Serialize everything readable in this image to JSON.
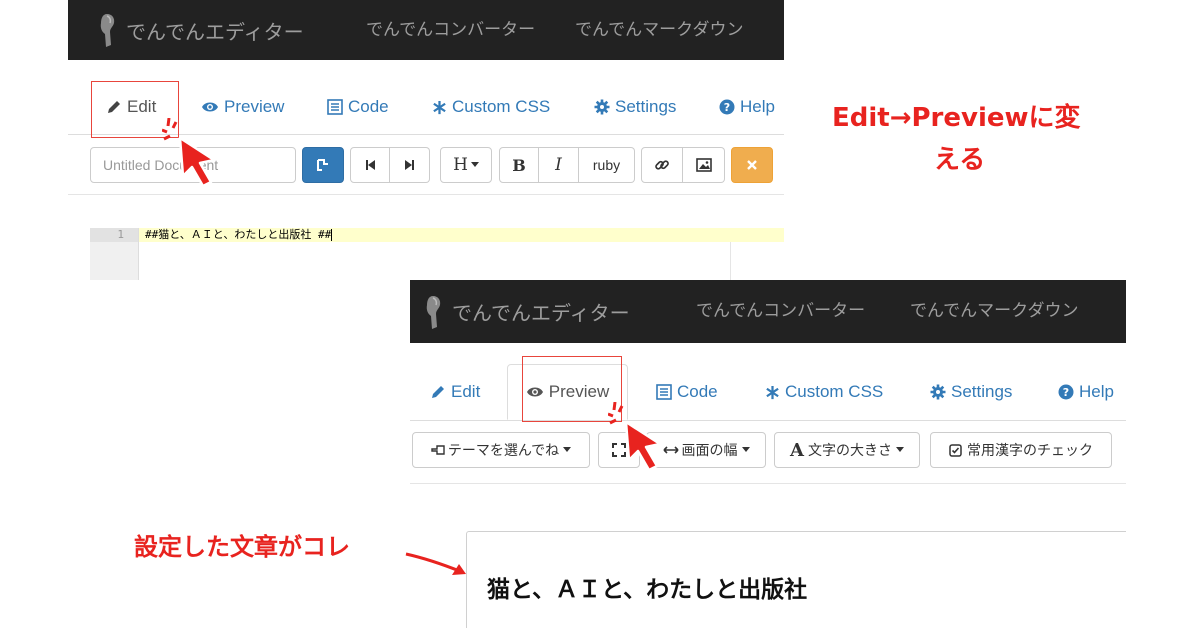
{
  "edit_screen": {
    "brand": "でんでんエディター",
    "nav": [
      "でんでんコンバーター",
      "でんでんマークダウン"
    ],
    "tabs": [
      {
        "label": "Edit",
        "icon": "pencil-icon"
      },
      {
        "label": "Preview",
        "icon": "eye-icon"
      },
      {
        "label": "Code",
        "icon": "list-icon"
      },
      {
        "label": "Custom CSS",
        "icon": "asterisk-icon"
      },
      {
        "label": "Settings",
        "icon": "gear-icon"
      },
      {
        "label": "Help",
        "icon": "question-circle-icon"
      }
    ],
    "active_tab": "Edit",
    "toolbar": {
      "title_placeholder": "Untitled Document",
      "heading_label": "H",
      "bold_label": "B",
      "italic_label": "I",
      "ruby_label": "ruby"
    },
    "editor": {
      "line_number": "1",
      "line_text": "##猫と、ＡＩと、わたしと出版社 ##"
    }
  },
  "preview_screen": {
    "brand": "でんでんエディター",
    "nav": [
      "でんでんコンバーター",
      "でんでんマークダウン"
    ],
    "tabs": [
      {
        "label": "Edit",
        "icon": "pencil-icon"
      },
      {
        "label": "Preview",
        "icon": "eye-icon"
      },
      {
        "label": "Code",
        "icon": "list-icon"
      },
      {
        "label": "Custom CSS",
        "icon": "asterisk-icon"
      },
      {
        "label": "Settings",
        "icon": "gear-icon"
      },
      {
        "label": "Help",
        "icon": "question-circle-icon"
      }
    ],
    "active_tab": "Preview",
    "toolbar": {
      "theme_label": "テーマを選んでね",
      "width_label": "画面の幅",
      "fontsize_label": "文字の大きさ",
      "kanji_label": "常用漢字のチェック"
    },
    "preview_heading": "猫と、ＡＩと、わたしと出版社"
  },
  "annotations": {
    "tab_change_line1": "Edit→Previewに変",
    "tab_change_line2": "える",
    "result_label": "設定した文章がコレ"
  },
  "colors": {
    "navbar": "#222222",
    "link": "#337ab7",
    "annotation": "#e8231f",
    "primary_button": "#337ab7",
    "warning_button": "#f0ad4e",
    "editor_line_highlight": "#ffffcc"
  }
}
